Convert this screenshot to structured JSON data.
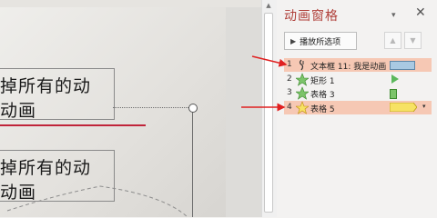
{
  "slide": {
    "textbox_1_lines": [
      "掉所有的动",
      "动画"
    ],
    "textbox_2_lines": [
      "掉所有的动",
      "动画"
    ]
  },
  "pane": {
    "title": "动画窗格",
    "play_button_label": "播放所选项",
    "up_arrow": "▲",
    "down_arrow": "▼",
    "dropdown_icon": "▾",
    "close_icon": "✕",
    "items": [
      {
        "num": "1",
        "name": "文本框 11: 我是动画",
        "icon": "click-trigger-icon",
        "bar_color": "#a9c9e2",
        "highlighted": true
      },
      {
        "num": "2",
        "name": "矩形 1",
        "icon": "entrance-star-icon",
        "bar_color": "#5cb85c",
        "highlighted": false
      },
      {
        "num": "3",
        "name": "表格 3",
        "icon": "entrance-star-icon",
        "bar_color": "#7cc46a",
        "highlighted": false
      },
      {
        "num": "4",
        "name": "表格 5",
        "icon": "emphasis-star-icon",
        "bar_color": "#f7e264",
        "highlighted": true
      }
    ]
  },
  "colors": {
    "pane_title": "#b0403a",
    "highlight_row": "#f6c8b4",
    "annotation_arrow": "#e02020"
  }
}
